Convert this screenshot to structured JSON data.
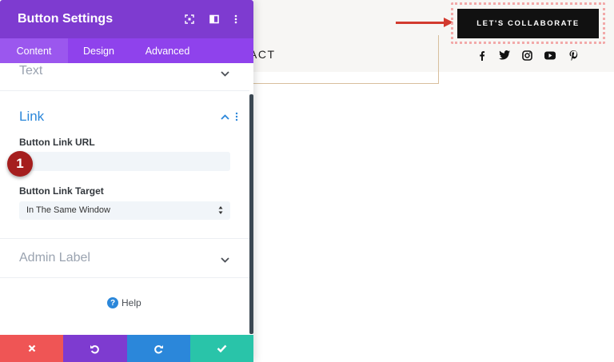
{
  "website": {
    "nav_partial": "ACT",
    "cta_label": "LET'S COLLABORATE",
    "social_icons": [
      "facebook-icon",
      "twitter-icon",
      "instagram-icon",
      "youtube-icon",
      "pinterest-icon"
    ]
  },
  "panel": {
    "title": "Button Settings",
    "header_icons": [
      "expand-icon",
      "split-view-icon",
      "more-vertical-icon"
    ],
    "tabs": [
      {
        "label": "Content",
        "active": true
      },
      {
        "label": "Design",
        "active": false
      },
      {
        "label": "Advanced",
        "active": false
      }
    ],
    "sections": {
      "text": {
        "title": "Text",
        "expanded": false
      },
      "link": {
        "title": "Link",
        "expanded": true,
        "url_label": "Button Link URL",
        "url_value": "",
        "target_label": "Button Link Target",
        "target_value": "In The Same Window"
      },
      "admin_label": {
        "title": "Admin Label",
        "expanded": false
      }
    },
    "help_label": "Help",
    "callout_number": "1",
    "footer_actions": [
      "discard",
      "undo",
      "redo",
      "save"
    ]
  },
  "colors": {
    "header_purple": "#7e3bd0",
    "tabs_purple": "#8f42ec",
    "link_blue": "#2b87da",
    "discard_red": "#ef5555",
    "undo_purple": "#7e3bd0",
    "redo_blue": "#2b87da",
    "save_green": "#29c4a9",
    "callout_red": "#a51e1e",
    "arrow_red": "#d23a2f"
  }
}
